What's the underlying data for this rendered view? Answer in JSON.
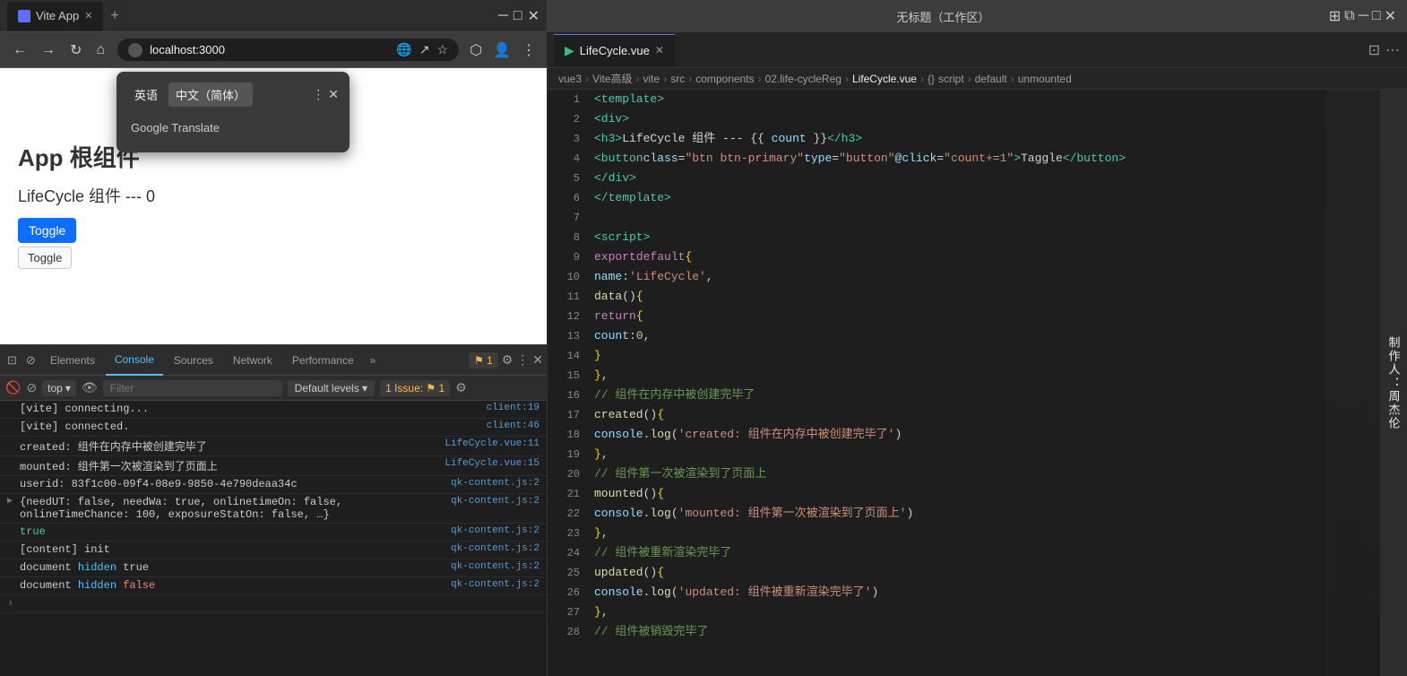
{
  "browser": {
    "tab_title": "Vite App",
    "address": "localhost:3000",
    "nav_back": "←",
    "nav_forward": "→",
    "nav_refresh": "↻",
    "nav_home": "⌂",
    "translate_popup": {
      "lang_from": "英语",
      "lang_to": "中文（简体）",
      "result": "Google Translate"
    }
  },
  "web_page": {
    "app_title": "App 根组件",
    "component_title": "LifeCycle 组件 --- 0",
    "btn1_label": "Toggle",
    "btn2_label": "Toggle"
  },
  "devtools": {
    "tabs": [
      "Elements",
      "Console",
      "Sources",
      "Network",
      "Performance"
    ],
    "active_tab": "Console",
    "more_label": "»",
    "console_toolbar": {
      "top_label": "top",
      "filter_placeholder": "Filter",
      "level_label": "Default levels ▾",
      "issue_label": "1 Issue: ⚑ 1"
    },
    "logs": [
      {
        "text": "[vite] connecting...",
        "source": "client:19",
        "type": "normal",
        "expandable": false
      },
      {
        "text": "[vite] connected.",
        "source": "client:46",
        "type": "normal",
        "expandable": false
      },
      {
        "text": "created: 组件在内存中被创建完毕了",
        "source": "LifeCycle.vue:11",
        "type": "normal",
        "expandable": false
      },
      {
        "text": "mounted: 组件第一次被渲染到了页面上",
        "source": "LifeCycle.vue:15",
        "type": "normal",
        "expandable": false
      },
      {
        "text": "userid: 83f1c00-09f4-08e9-9850-4e790deaa34c",
        "source": "qk-content.js:2",
        "type": "normal",
        "expandable": false
      },
      {
        "text": "{needUT: false, needWa: true, onlinetimeOn: false, onlineTimeChance: 100, exposureStatOn: false, …}",
        "source": "qk-content.js:2",
        "type": "object",
        "expandable": true
      },
      {
        "text": "true",
        "source": "qk-content.js:2",
        "type": "bool-true",
        "expandable": false
      },
      {
        "text": "[content] init",
        "source": "qk-content.js:2",
        "type": "normal",
        "expandable": false
      },
      {
        "text": "document hidden true",
        "source": "qk-content.js:2",
        "type": "normal",
        "expandable": false
      },
      {
        "text": "document hidden false",
        "source": "qk-content.js:2",
        "type": "normal",
        "expandable": false
      }
    ]
  },
  "editor": {
    "tab_label": "LifeCycle.vue",
    "breadcrumb": [
      "vue3",
      "Vite高级",
      "vite",
      "src",
      "components",
      "02.life-cycleReg",
      "LifeCycle.vue",
      "script",
      "default",
      "unmounted"
    ],
    "code_lines": [
      {
        "num": 1,
        "text": "<template>"
      },
      {
        "num": 2,
        "text": "  <div>"
      },
      {
        "num": 3,
        "text": "    <h3>LifeCycle 组件 --- {{ count }}</h3>"
      },
      {
        "num": 4,
        "text": "    <button class=\"btn btn-primary\" type=\"button\" @click=\"count+=1\">Taggle</button>"
      },
      {
        "num": 5,
        "text": "  </div>"
      },
      {
        "num": 6,
        "text": "</template>"
      },
      {
        "num": 7,
        "text": ""
      },
      {
        "num": 8,
        "text": "<script>"
      },
      {
        "num": 9,
        "text": "export default {"
      },
      {
        "num": 10,
        "text": "  name: 'LifeCycle',"
      },
      {
        "num": 11,
        "text": "  data() {"
      },
      {
        "num": 12,
        "text": "    return {"
      },
      {
        "num": 13,
        "text": "      count: 0,"
      },
      {
        "num": 14,
        "text": "    }"
      },
      {
        "num": 15,
        "text": "  },"
      },
      {
        "num": 16,
        "text": "  // 组件在内存中被创建完毕了"
      },
      {
        "num": 17,
        "text": "  created() {"
      },
      {
        "num": 18,
        "text": "    console.log('created: 组件在内存中被创建完毕了')"
      },
      {
        "num": 19,
        "text": "  },"
      },
      {
        "num": 20,
        "text": "  // 组件第一次被渲染到了页面上"
      },
      {
        "num": 21,
        "text": "  mounted() {"
      },
      {
        "num": 22,
        "text": "    console.log('mounted: 组件第一次被渲染到了页面上')"
      },
      {
        "num": 23,
        "text": "  },"
      },
      {
        "num": 24,
        "text": "  // 组件被重新渲染完毕了"
      },
      {
        "num": 25,
        "text": "  updated() {"
      },
      {
        "num": 26,
        "text": "    console.log('updated: 组件被重新渲染完毕了')"
      },
      {
        "num": 27,
        "text": "  },"
      },
      {
        "num": 28,
        "text": "  // 组件被销毁完毕了"
      }
    ],
    "author_label": "制作人：周杰伦"
  },
  "vscode": {
    "title": "无标题（工作区）"
  }
}
